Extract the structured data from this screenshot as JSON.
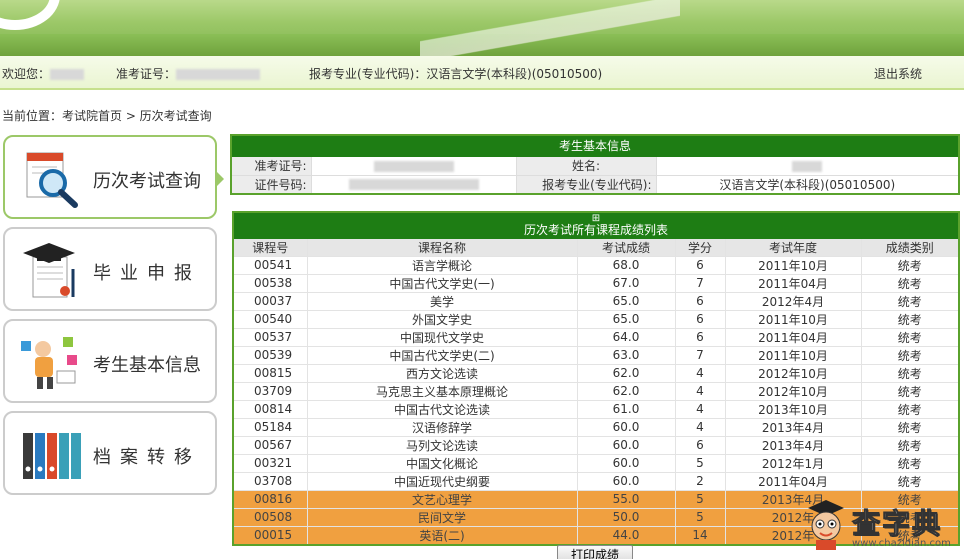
{
  "header": {
    "welcome_label": "欢迎您：",
    "ticket_label": "准考证号：",
    "major_label": "报考专业(专业代码)：汉语言文学(本科段)(05010500)",
    "logout": "退出系统"
  },
  "breadcrumb": "当前位置：考试院首页 > 历次考试查询",
  "menu": [
    {
      "label": "历次考试查询",
      "icon": "magnifier-document-icon"
    },
    {
      "label": "毕业申报",
      "icon": "graduation-cap-icon"
    },
    {
      "label": "考生基本信息",
      "icon": "student-figure-icon"
    },
    {
      "label": "档案转移",
      "icon": "binders-icon"
    }
  ],
  "info": {
    "title": "考生基本信息",
    "ticket_label": "准考证号:",
    "name_label": "姓名:",
    "id_label": "证件号码:",
    "major_label": "报考专业(专业代码):",
    "major_value": "汉语言文学(本科段)(05010500)"
  },
  "scores": {
    "expand_glyph": "⊞",
    "title": "历次考试所有课程成绩列表",
    "columns": [
      "课程号",
      "课程名称",
      "考试成绩",
      "学分",
      "考试年度",
      "成绩类别"
    ],
    "rows": [
      [
        "00541",
        "语言学概论",
        "68.0",
        "6",
        "2011年10月",
        "统考"
      ],
      [
        "00538",
        "中国古代文学史(一)",
        "67.0",
        "7",
        "2011年04月",
        "统考"
      ],
      [
        "00037",
        "美学",
        "65.0",
        "6",
        "2012年4月",
        "统考"
      ],
      [
        "00540",
        "外国文学史",
        "65.0",
        "6",
        "2011年10月",
        "统考"
      ],
      [
        "00537",
        "中国现代文学史",
        "64.0",
        "6",
        "2011年04月",
        "统考"
      ],
      [
        "00539",
        "中国古代文学史(二)",
        "63.0",
        "7",
        "2011年10月",
        "统考"
      ],
      [
        "00815",
        "西方文论选读",
        "62.0",
        "4",
        "2012年10月",
        "统考"
      ],
      [
        "03709",
        "马克思主义基本原理概论",
        "62.0",
        "4",
        "2012年10月",
        "统考"
      ],
      [
        "00814",
        "中国古代文论选读",
        "61.0",
        "4",
        "2013年10月",
        "统考"
      ],
      [
        "05184",
        "汉语修辞学",
        "60.0",
        "4",
        "2013年4月",
        "统考"
      ],
      [
        "00567",
        "马列文论选读",
        "60.0",
        "6",
        "2013年4月",
        "统考"
      ],
      [
        "00321",
        "中国文化概论",
        "60.0",
        "5",
        "2012年1月",
        "统考"
      ],
      [
        "03708",
        "中国近现代史纲要",
        "60.0",
        "2",
        "2011年04月",
        "统考"
      ],
      [
        "00816",
        "文艺心理学",
        "55.0",
        "5",
        "2013年4月",
        "统考"
      ],
      [
        "00508",
        "民间文学",
        "50.0",
        "5",
        "2012年",
        "统考"
      ],
      [
        "00015",
        "英语(二)",
        "44.0",
        "14",
        "2012年",
        "统考"
      ]
    ],
    "highlight_from": 13,
    "highlight_color": "#f0a040"
  },
  "print_button": "打印成绩",
  "watermark": {
    "word": "查字典",
    "url": "www.chazidian.com"
  },
  "colors": {
    "header_green": "#1e7d14",
    "frame_green": "#5aa22c",
    "menu_active": "#9cc868"
  }
}
